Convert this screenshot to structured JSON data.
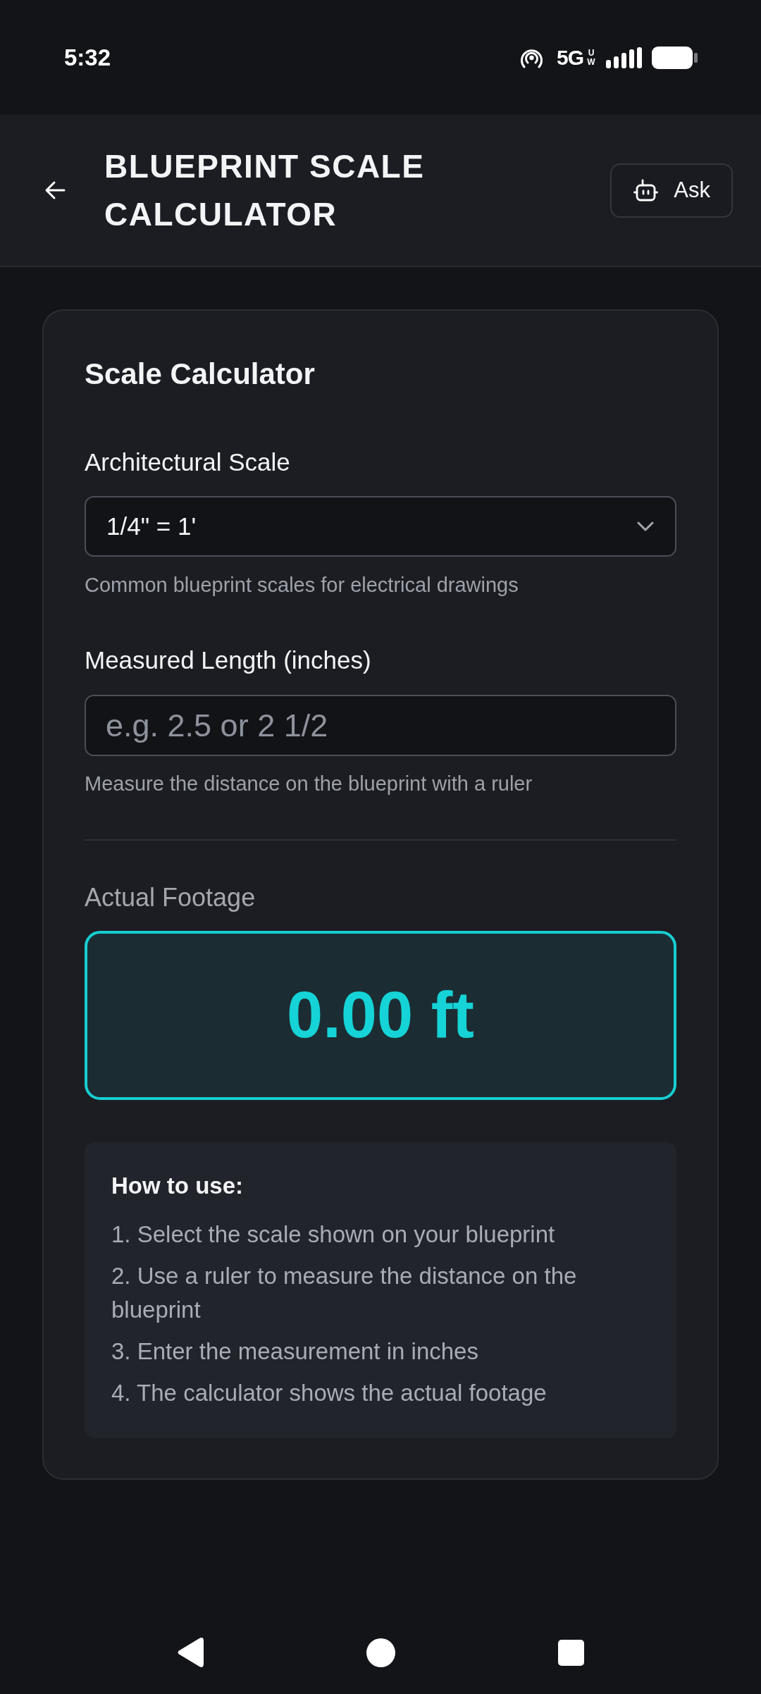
{
  "status_bar": {
    "time": "5:32",
    "network": "5G",
    "network_sub": "UW"
  },
  "app_bar": {
    "title": "BLUEPRINT SCALE CALCULATOR",
    "ask_button": "Ask"
  },
  "card": {
    "title": "Scale Calculator",
    "scale_field": {
      "label": "Architectural Scale",
      "value": "1/4\" = 1'",
      "hint": "Common blueprint scales for electrical drawings"
    },
    "length_field": {
      "label": "Measured Length (inches)",
      "placeholder": "e.g. 2.5 or 2 1/2",
      "hint": "Measure the distance on the blueprint with a ruler"
    },
    "result": {
      "label": "Actual Footage",
      "value": "0.00 ft"
    },
    "instructions": {
      "title": "How to use:",
      "steps": [
        "1. Select the scale shown on your blueprint",
        "2. Use a ruler to measure the distance on the blueprint",
        "3. Enter the measurement in inches",
        "4. The calculator shows the actual footage"
      ]
    }
  }
}
